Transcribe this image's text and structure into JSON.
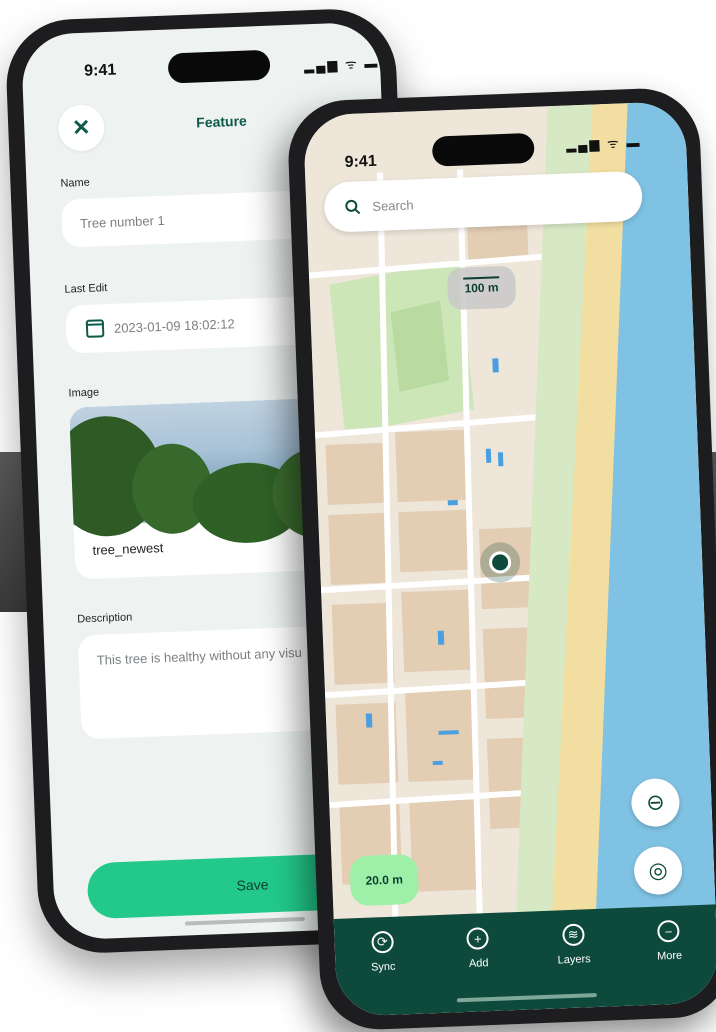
{
  "feature_form": {
    "status_time": "9:41",
    "status_icons": "▂▄▆ ᯤ ▬",
    "title": "Feature",
    "close_glyph": "✕",
    "name_label": "Name",
    "name_value": "Tree number 1",
    "last_edit_label": "Last Edit",
    "last_edit_value": "2023-01-09 18:02:12",
    "image_label": "Image",
    "image_name": "tree_newest",
    "description_label": "Description",
    "description_value": "This tree is healthy without any visu",
    "save_label": "Save"
  },
  "map_screen": {
    "status_time": "9:41",
    "status_icons": "▂▄▆ ᯤ ▬",
    "search_placeholder": "Search",
    "scale_label": "100 m",
    "distance_label": "20.0 m",
    "zoom_out_glyph": "⊖",
    "locate_glyph": "◎",
    "nav": [
      {
        "label": "Sync",
        "glyph": "⟳",
        "icon": "sync-icon"
      },
      {
        "label": "Add",
        "glyph": "+",
        "icon": "add-icon"
      },
      {
        "label": "Layers",
        "glyph": "≋",
        "icon": "layers-icon"
      },
      {
        "label": "More",
        "glyph": "−",
        "icon": "more-icon"
      }
    ]
  },
  "colors": {
    "primary": "#0e4a3c",
    "accent": "#22c98a",
    "water": "#7fc2e3",
    "beach": "#f2dea0"
  }
}
